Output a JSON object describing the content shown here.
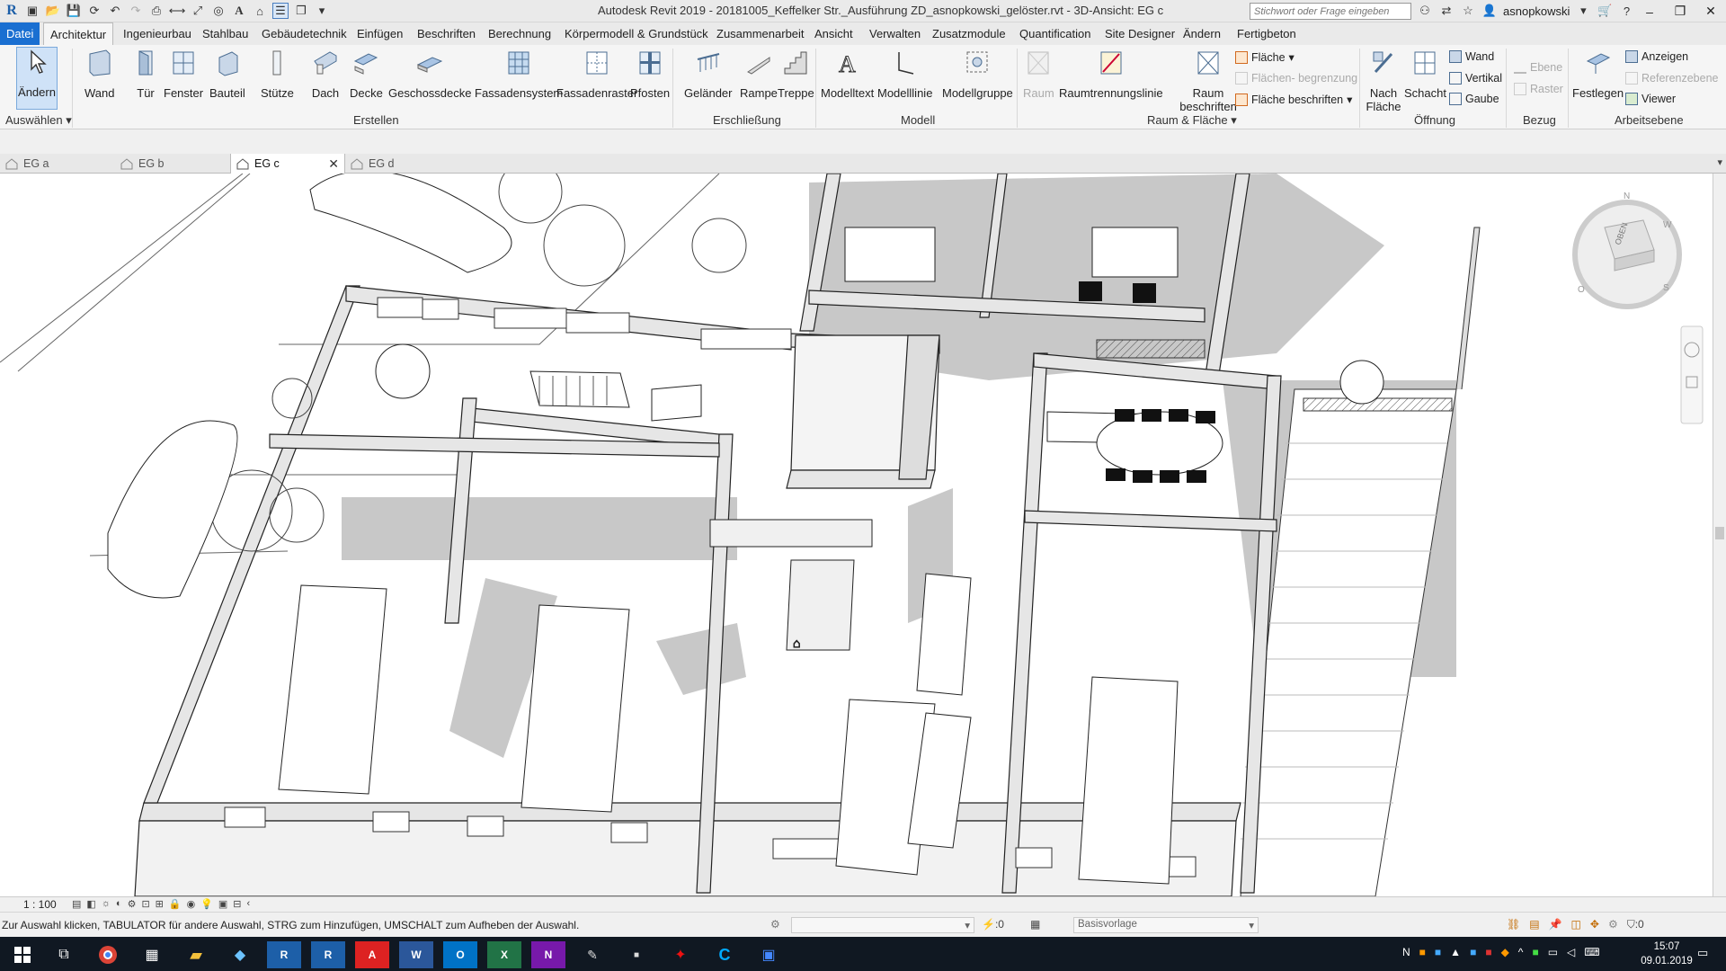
{
  "app": {
    "title": "Autodesk Revit 2019 - 20181005_Keffelker Str._Ausführung ZD_asnopkowski_gelöster.rvt - 3D-Ansicht: EG c",
    "search_placeholder": "Stichwort oder Frage eingeben",
    "user": "asnopkowski",
    "brand_color": "#1a6fd1"
  },
  "menu_tabs": [
    "Datei",
    "Architektur",
    "Ingenieurbau",
    "Stahlbau",
    "Gebäudetechnik",
    "Einfügen",
    "Beschriften",
    "Berechnung",
    "Körpermodell & Grundstück",
    "Zusammenarbeit",
    "Ansicht",
    "Verwalten",
    "Zusatzmodule",
    "Quantification",
    "Site Designer",
    "Ändern",
    "Fertigbeton"
  ],
  "active_tab": "Architektur",
  "ribbon": {
    "aendern": "Ändern",
    "auswaehlen": "Auswählen",
    "erstellen": {
      "label": "Erstellen",
      "items": [
        "Wand",
        "Tür",
        "Fenster",
        "Bauteil",
        "Stütze",
        "Dach",
        "Decke",
        "Geschossdecke",
        "Fassadensystem",
        "Fassadenraster",
        "Pfosten"
      ]
    },
    "erschliessung": {
      "label": "Erschließung",
      "items": [
        "Geländer",
        "Rampe",
        "Treppe"
      ]
    },
    "modell": {
      "label": "Modell",
      "items": [
        "Modelltext",
        "Modelllinie",
        "Modellgruppe"
      ]
    },
    "raum_flaeche": {
      "label": "Raum & Fläche",
      "items": [
        "Raum",
        "Raumtrennungslinie",
        "Raum beschriften"
      ],
      "small": [
        "Fläche",
        "Flächen- begrenzung",
        "Fläche beschriften"
      ]
    },
    "oeffnung": {
      "label": "Öffnung",
      "items": [
        "Nach Fläche",
        "Schacht"
      ],
      "small": [
        "Wand",
        "Vertikal",
        "Gaube"
      ]
    },
    "bezug": {
      "label": "Bezug",
      "small": [
        "Ebene",
        "Raster"
      ]
    },
    "arbeitsebene": {
      "label": "Arbeitsebene",
      "items": [
        "Festlegen"
      ],
      "small": [
        "Anzeigen",
        "Referenzebene",
        "Viewer"
      ]
    }
  },
  "view_tabs": [
    {
      "label": "EG a",
      "active": false
    },
    {
      "label": "EG b",
      "active": false
    },
    {
      "label": "EG c",
      "active": true
    },
    {
      "label": "EG d",
      "active": false
    }
  ],
  "viewcube": {
    "face": "OBEN",
    "compass": [
      "N",
      "O",
      "S",
      "W"
    ]
  },
  "view_bar": {
    "scale": "1 : 100"
  },
  "status": {
    "message": "Zur Auswahl klicken, TABULATOR für andere Auswahl, STRG zum Hinzufügen, UMSCHALT zum Aufheben der Auswahl.",
    "count_left": ":0",
    "template": "Basisvorlage",
    "count_right": ":0"
  },
  "taskbar": {
    "time": "15:07",
    "date": "09.01.2019"
  }
}
